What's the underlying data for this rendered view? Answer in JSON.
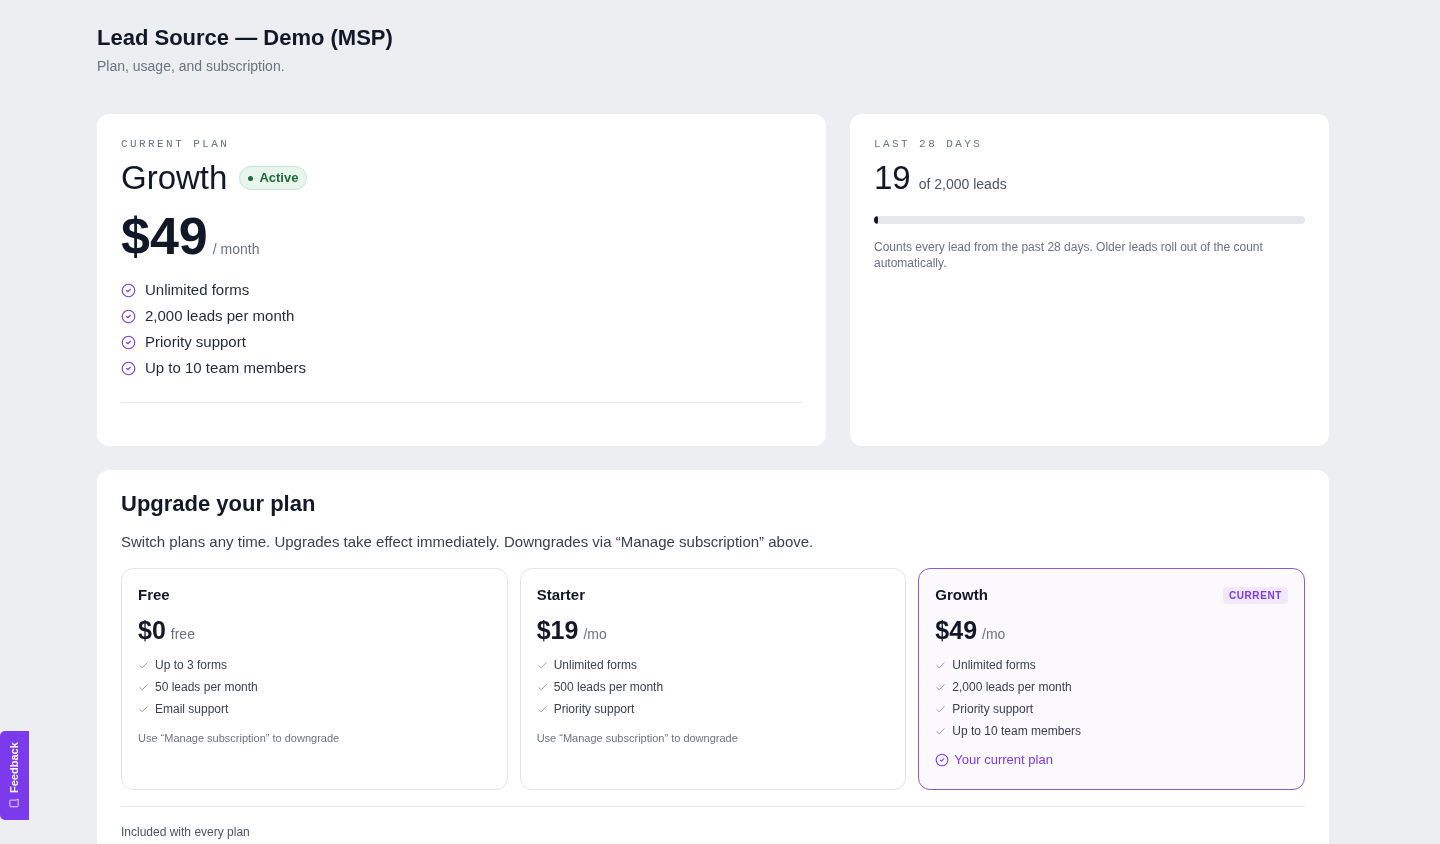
{
  "header": {
    "title": "Lead Source — Demo (MSP)",
    "subtitle": "Plan, usage, and subscription."
  },
  "current_plan": {
    "eyebrow": "CURRENT PLAN",
    "name": "Growth",
    "status": "Active",
    "price": "$49",
    "period": "/ month",
    "features": [
      "Unlimited forms",
      "2,000 leads per month",
      "Priority support",
      "Up to 10 team members"
    ]
  },
  "usage": {
    "eyebrow": "LAST 28 DAYS",
    "count": "19",
    "total": "of 2,000 leads",
    "level": 0.01,
    "note": "Counts every lead from the past 28 days. Older leads roll out of the count automatically."
  },
  "upgrade": {
    "title": "Upgrade your plan",
    "description": "Switch plans any time. Upgrades take effect immediately. Downgrades via “Manage subscription” above.",
    "plans": [
      {
        "name": "Free",
        "price": "$0",
        "period": "free",
        "selected": false,
        "features": [
          "Up to 3 forms",
          "50 leads per month",
          "Email support"
        ],
        "footer": {
          "kind": "note",
          "text": "Use “Manage subscription” to downgrade"
        }
      },
      {
        "name": "Starter",
        "price": "$19",
        "period": "/mo",
        "selected": false,
        "features": [
          "Unlimited forms",
          "500 leads per month",
          "Priority support"
        ],
        "footer": {
          "kind": "note",
          "text": "Use “Manage subscription” to downgrade"
        }
      },
      {
        "name": "Growth",
        "price": "$49",
        "period": "/mo",
        "selected": true,
        "badge": "CURRENT",
        "features": [
          "Unlimited forms",
          "2,000 leads per month",
          "Priority support",
          "Up to 10 team members"
        ],
        "footer": {
          "kind": "current",
          "text": "Your current plan"
        }
      }
    ],
    "included_title": "Included with every plan"
  },
  "feedback_tab": {
    "label": "Feedback"
  }
}
